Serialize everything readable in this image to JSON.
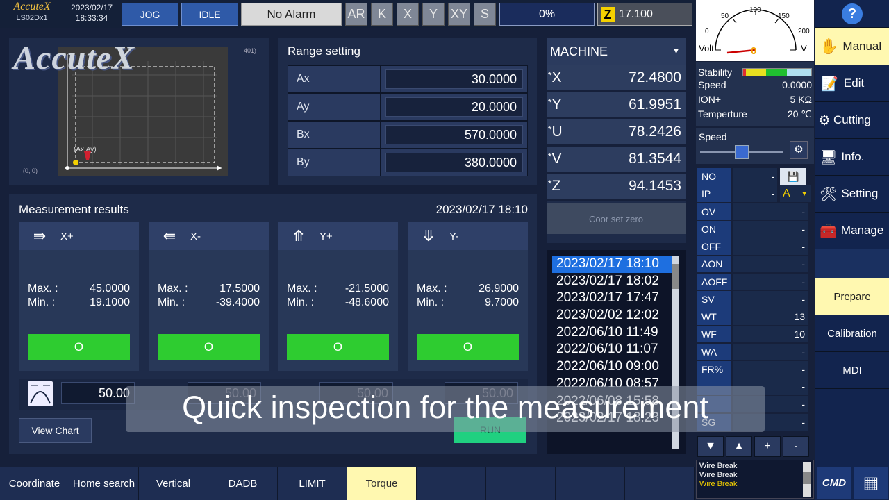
{
  "topbar": {
    "brand": "AccuteX",
    "model": "LS02Dx1",
    "date": "2023/02/17",
    "time": "18:33:34",
    "jog": "JOG",
    "idle": "IDLE",
    "alarm": "No Alarm",
    "axis_buttons": [
      "AR",
      "K",
      "X",
      "Y",
      "XY",
      "S"
    ],
    "progress": "0%",
    "z_label": "Z",
    "z_value": "17.100"
  },
  "meter": {
    "ticks": [
      "0",
      "50",
      "100",
      "150",
      "200"
    ],
    "left_label": "Volt",
    "right_label": "V",
    "reading": "0"
  },
  "status": {
    "stability_label": "Stability",
    "speed_label": "Speed",
    "speed_value": "0.0000",
    "ion_label": "ION+",
    "ion_value": "5 KΩ",
    "temp_label": "Temperture",
    "temp_value": "20 ℃"
  },
  "speed_slider": {
    "label": "Speed",
    "value_fraction": 0.5
  },
  "preview": {
    "logo_text": "AccuteX",
    "coord_tr": "401)",
    "point_label": "(Ax,Ay)",
    "origin": "(0, 0)"
  },
  "range": {
    "title": "Range setting",
    "rows": [
      {
        "label": "Ax",
        "value": "30.0000"
      },
      {
        "label": "Ay",
        "value": "20.0000"
      },
      {
        "label": "Bx",
        "value": "570.0000"
      },
      {
        "label": "By",
        "value": "380.0000"
      }
    ]
  },
  "machine": {
    "title": "MACHINE",
    "rows": [
      {
        "axis": "X",
        "value": "72.4800"
      },
      {
        "axis": "Y",
        "value": "61.9951"
      },
      {
        "axis": "U",
        "value": "78.2426"
      },
      {
        "axis": "V",
        "value": "81.3544"
      },
      {
        "axis": "Z",
        "value": "94.1453"
      }
    ],
    "coor_button": "Coor set zero"
  },
  "measurement": {
    "title": "Measurement results",
    "date": "2023/02/17 18:10",
    "max_label": "Max. :",
    "min_label": "Min. :",
    "cards": [
      {
        "name": "X+",
        "max": "45.0000",
        "min": "19.1000",
        "result": "O"
      },
      {
        "name": "X-",
        "max": "17.5000",
        "min": "-39.4000",
        "result": "O"
      },
      {
        "name": "Y+",
        "max": "-21.5000",
        "min": "-48.6000",
        "result": "O"
      },
      {
        "name": "Y-",
        "max": "26.9000",
        "min": "9.7000",
        "result": "O"
      }
    ],
    "threshold_value": "50.00",
    "threshold_ghost": [
      "50.00",
      "50.00",
      "50.00"
    ],
    "view_chart": "View Chart",
    "run": "RUN"
  },
  "history": [
    "2023/02/17 18:10",
    "2023/02/17 18:02",
    "2023/02/17 17:47",
    "2023/02/02 12:02",
    "2022/06/10 11:49",
    "2022/06/10 11:07",
    "2022/06/10 09:00",
    "2022/06/10 08:57",
    "2022/06/08 15:58",
    "2023/02/17 18:23"
  ],
  "params": {
    "rows": [
      {
        "k": "NO",
        "v": "-"
      },
      {
        "k": "IP",
        "v": "-"
      },
      {
        "k": "OV",
        "v": "-"
      },
      {
        "k": "ON",
        "v": "-"
      },
      {
        "k": "OFF",
        "v": "-"
      },
      {
        "k": "AON",
        "v": "-"
      },
      {
        "k": "AOFF",
        "v": "-"
      },
      {
        "k": "SV",
        "v": "-"
      },
      {
        "k": "WT",
        "v": "13"
      },
      {
        "k": "WF",
        "v": "10"
      },
      {
        "k": "WA",
        "v": "-"
      },
      {
        "k": "FR%",
        "v": "-"
      },
      {
        "k": "",
        "v": "-"
      },
      {
        "k": "",
        "v": "-"
      },
      {
        "k": "SG",
        "v": "-"
      }
    ],
    "ip_select": "A",
    "controls": [
      "▼",
      "▲",
      "+",
      "-"
    ]
  },
  "messages": [
    "Wire Break",
    "Wire Break",
    "Wire Break"
  ],
  "sidebar": {
    "help": "?",
    "manual": "Manual",
    "edit": "Edit",
    "cutting": "Cutting",
    "info": "Info.",
    "setting": "Setting",
    "manage": "Manage",
    "prepare": "Prepare",
    "calibration": "Calibration",
    "mdi": "MDI",
    "cmd": "CMD"
  },
  "tabs": [
    "Coordinate",
    "Home search",
    "Vertical",
    "DADB",
    "LIMIT",
    "Torque"
  ],
  "caption": "Quick inspection for the measurement",
  "colors": {
    "accent": "#2f5aa8",
    "ok": "#2ecc30",
    "active_tab": "#fff8b0",
    "selected": "#1e6fe0"
  }
}
